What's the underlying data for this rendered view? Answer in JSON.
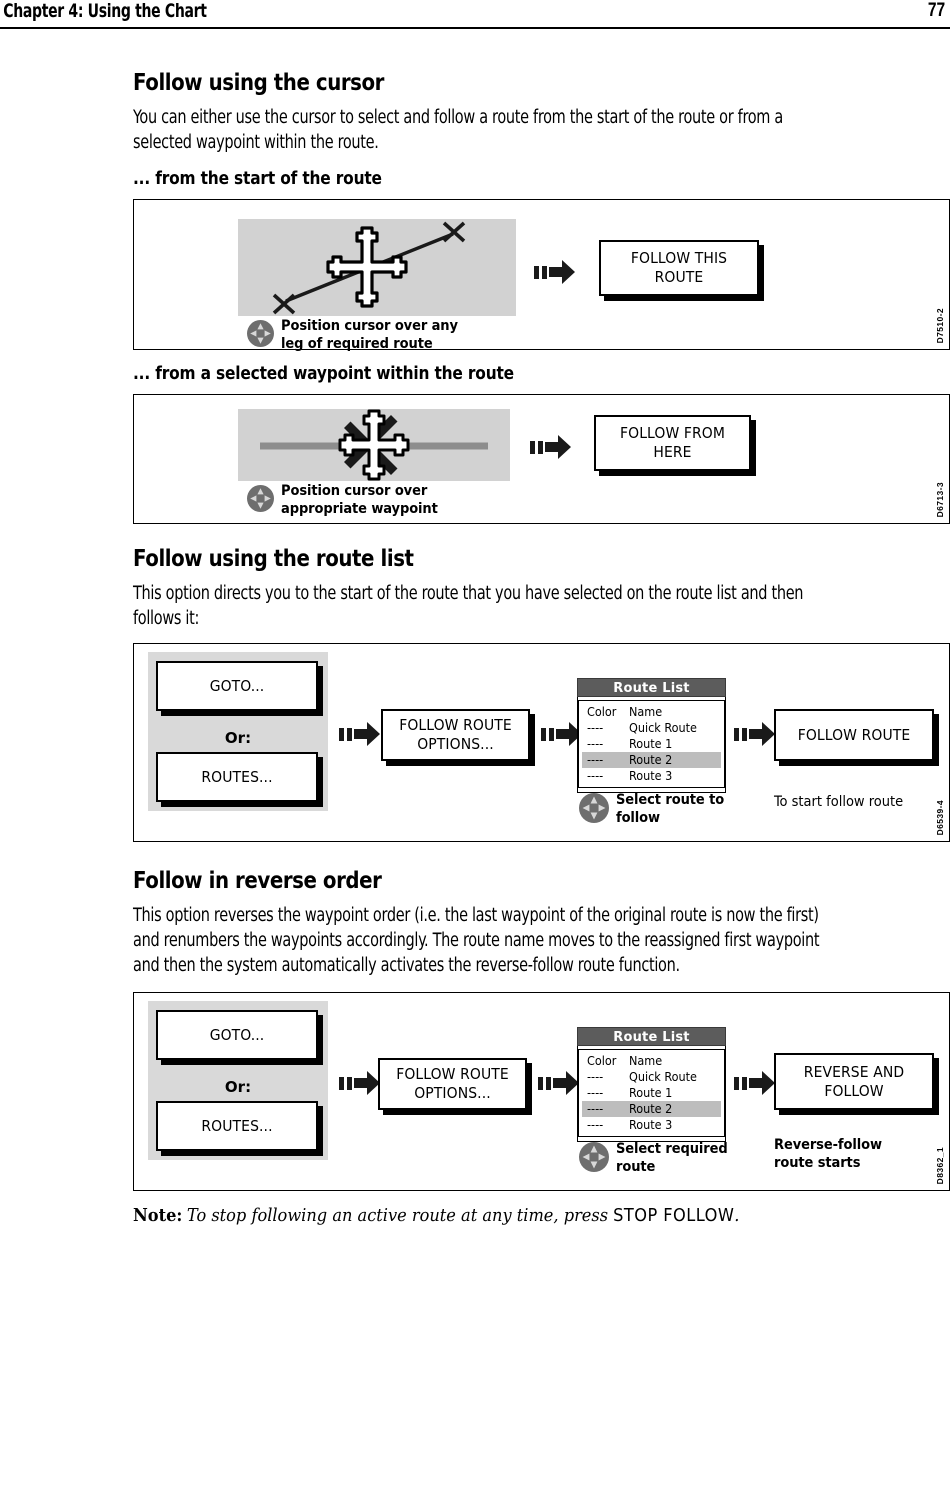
{
  "header": {
    "chapter_title": "Chapter 4: Using the Chart",
    "page_number": "77"
  },
  "sections": {
    "cursor": {
      "heading": "Follow using the cursor",
      "body": "You can either use the cursor to select and follow a route from the start of the route or from a selected waypoint within the route.",
      "sub1_heading": "... from the start of the route",
      "sub2_heading": "... from a selected waypoint within the route"
    },
    "route_list": {
      "heading": "Follow using the route list",
      "body": "This option directs you to the start of the route that you have selected on the route list and then follows it:"
    },
    "reverse": {
      "heading": "Follow in reverse order",
      "body": "This option reverses the waypoint order (i.e. the last waypoint of the original route is now the first) and renumbers the waypoints accordingly. The route name moves to the reassigned first waypoint and then the system automatically activates the reverse-follow route function."
    }
  },
  "figures": {
    "fig1": {
      "id_label": "D7510-2",
      "caption_line1": "Position cursor over any",
      "caption_line2": "leg of required route",
      "softkey_line1": "FOLLOW THIS",
      "softkey_line2": "ROUTE",
      "trackpad_icon": "trackpad-icon",
      "cursor_icon": "chart-cursor-icon",
      "waypoint_icon": "waypoint-cross-icon"
    },
    "fig2": {
      "id_label": "D6713-3",
      "caption_line1": "Position cursor over",
      "caption_line2": "appropriate waypoint",
      "softkey_line1": "FOLLOW FROM",
      "softkey_line2": "HERE",
      "trackpad_icon": "trackpad-icon",
      "cursor_icon": "chart-cursor-icon",
      "waypoint_icon": "waypoint-star-icon"
    },
    "fig3": {
      "id_label": "D6539-4",
      "goto_label": "GOTO...",
      "or_label": "Or:",
      "routes_label": "ROUTES...",
      "options_line1": "FOLLOW ROUTE",
      "options_line2": "OPTIONS...",
      "final_softkey": "FOLLOW ROUTE",
      "caption_line1": "Select route to",
      "caption_line2": "follow",
      "right_caption": "To start follow route",
      "route_list": {
        "title": "Route List",
        "columns": [
          "Color",
          "Name"
        ],
        "rows": [
          {
            "color": "----",
            "name": "Quick Route",
            "selected": false
          },
          {
            "color": "----",
            "name": "Route 1",
            "selected": false
          },
          {
            "color": "----",
            "name": "Route 2",
            "selected": true
          },
          {
            "color": "----",
            "name": "Route 3",
            "selected": false
          }
        ]
      }
    },
    "fig4": {
      "id_label": "D8362_1",
      "goto_label": "GOTO...",
      "or_label": "Or:",
      "routes_label": "ROUTES...",
      "options_line1": "FOLLOW ROUTE",
      "options_line2": "OPTIONS...",
      "final_softkey_line1": "REVERSE AND",
      "final_softkey_line2": "FOLLOW",
      "caption_line1": "Select required",
      "caption_line2": "route",
      "right_caption_line1": "Reverse-follow",
      "right_caption_line2": "route starts",
      "route_list": {
        "title": "Route List",
        "columns": [
          "Color",
          "Name"
        ],
        "rows": [
          {
            "color": "----",
            "name": "Quick Route",
            "selected": false
          },
          {
            "color": "----",
            "name": "Route 1",
            "selected": false
          },
          {
            "color": "----",
            "name": "Route 2",
            "selected": true
          },
          {
            "color": "----",
            "name": "Route 3",
            "selected": false
          }
        ]
      }
    }
  },
  "note": {
    "label": "Note:",
    "text": "To stop following an active route at any time, press ",
    "key": "STOP FOLLOW",
    "period": "."
  },
  "colors": {
    "screen_grey": "#d2d2d2",
    "group_grey": "#d9d9d9",
    "title_bar_grey": "#5c5c5c",
    "selection_grey": "#bdbdbd",
    "ink": "#000000"
  }
}
